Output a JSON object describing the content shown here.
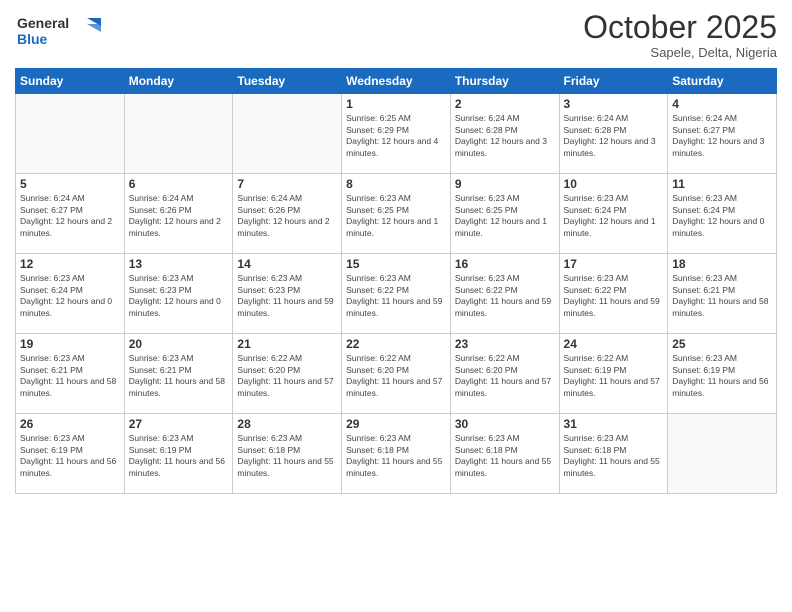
{
  "logo": {
    "text_general": "General",
    "text_blue": "Blue"
  },
  "header": {
    "month": "October 2025",
    "location": "Sapele, Delta, Nigeria"
  },
  "days_of_week": [
    "Sunday",
    "Monday",
    "Tuesday",
    "Wednesday",
    "Thursday",
    "Friday",
    "Saturday"
  ],
  "weeks": [
    [
      {
        "day": "",
        "sunrise": "",
        "sunset": "",
        "daylight": ""
      },
      {
        "day": "",
        "sunrise": "",
        "sunset": "",
        "daylight": ""
      },
      {
        "day": "",
        "sunrise": "",
        "sunset": "",
        "daylight": ""
      },
      {
        "day": "1",
        "sunrise": "Sunrise: 6:25 AM",
        "sunset": "Sunset: 6:29 PM",
        "daylight": "Daylight: 12 hours and 4 minutes."
      },
      {
        "day": "2",
        "sunrise": "Sunrise: 6:24 AM",
        "sunset": "Sunset: 6:28 PM",
        "daylight": "Daylight: 12 hours and 3 minutes."
      },
      {
        "day": "3",
        "sunrise": "Sunrise: 6:24 AM",
        "sunset": "Sunset: 6:28 PM",
        "daylight": "Daylight: 12 hours and 3 minutes."
      },
      {
        "day": "4",
        "sunrise": "Sunrise: 6:24 AM",
        "sunset": "Sunset: 6:27 PM",
        "daylight": "Daylight: 12 hours and 3 minutes."
      }
    ],
    [
      {
        "day": "5",
        "sunrise": "Sunrise: 6:24 AM",
        "sunset": "Sunset: 6:27 PM",
        "daylight": "Daylight: 12 hours and 2 minutes."
      },
      {
        "day": "6",
        "sunrise": "Sunrise: 6:24 AM",
        "sunset": "Sunset: 6:26 PM",
        "daylight": "Daylight: 12 hours and 2 minutes."
      },
      {
        "day": "7",
        "sunrise": "Sunrise: 6:24 AM",
        "sunset": "Sunset: 6:26 PM",
        "daylight": "Daylight: 12 hours and 2 minutes."
      },
      {
        "day": "8",
        "sunrise": "Sunrise: 6:23 AM",
        "sunset": "Sunset: 6:25 PM",
        "daylight": "Daylight: 12 hours and 1 minute."
      },
      {
        "day": "9",
        "sunrise": "Sunrise: 6:23 AM",
        "sunset": "Sunset: 6:25 PM",
        "daylight": "Daylight: 12 hours and 1 minute."
      },
      {
        "day": "10",
        "sunrise": "Sunrise: 6:23 AM",
        "sunset": "Sunset: 6:24 PM",
        "daylight": "Daylight: 12 hours and 1 minute."
      },
      {
        "day": "11",
        "sunrise": "Sunrise: 6:23 AM",
        "sunset": "Sunset: 6:24 PM",
        "daylight": "Daylight: 12 hours and 0 minutes."
      }
    ],
    [
      {
        "day": "12",
        "sunrise": "Sunrise: 6:23 AM",
        "sunset": "Sunset: 6:24 PM",
        "daylight": "Daylight: 12 hours and 0 minutes."
      },
      {
        "day": "13",
        "sunrise": "Sunrise: 6:23 AM",
        "sunset": "Sunset: 6:23 PM",
        "daylight": "Daylight: 12 hours and 0 minutes."
      },
      {
        "day": "14",
        "sunrise": "Sunrise: 6:23 AM",
        "sunset": "Sunset: 6:23 PM",
        "daylight": "Daylight: 11 hours and 59 minutes."
      },
      {
        "day": "15",
        "sunrise": "Sunrise: 6:23 AM",
        "sunset": "Sunset: 6:22 PM",
        "daylight": "Daylight: 11 hours and 59 minutes."
      },
      {
        "day": "16",
        "sunrise": "Sunrise: 6:23 AM",
        "sunset": "Sunset: 6:22 PM",
        "daylight": "Daylight: 11 hours and 59 minutes."
      },
      {
        "day": "17",
        "sunrise": "Sunrise: 6:23 AM",
        "sunset": "Sunset: 6:22 PM",
        "daylight": "Daylight: 11 hours and 59 minutes."
      },
      {
        "day": "18",
        "sunrise": "Sunrise: 6:23 AM",
        "sunset": "Sunset: 6:21 PM",
        "daylight": "Daylight: 11 hours and 58 minutes."
      }
    ],
    [
      {
        "day": "19",
        "sunrise": "Sunrise: 6:23 AM",
        "sunset": "Sunset: 6:21 PM",
        "daylight": "Daylight: 11 hours and 58 minutes."
      },
      {
        "day": "20",
        "sunrise": "Sunrise: 6:23 AM",
        "sunset": "Sunset: 6:21 PM",
        "daylight": "Daylight: 11 hours and 58 minutes."
      },
      {
        "day": "21",
        "sunrise": "Sunrise: 6:22 AM",
        "sunset": "Sunset: 6:20 PM",
        "daylight": "Daylight: 11 hours and 57 minutes."
      },
      {
        "day": "22",
        "sunrise": "Sunrise: 6:22 AM",
        "sunset": "Sunset: 6:20 PM",
        "daylight": "Daylight: 11 hours and 57 minutes."
      },
      {
        "day": "23",
        "sunrise": "Sunrise: 6:22 AM",
        "sunset": "Sunset: 6:20 PM",
        "daylight": "Daylight: 11 hours and 57 minutes."
      },
      {
        "day": "24",
        "sunrise": "Sunrise: 6:22 AM",
        "sunset": "Sunset: 6:19 PM",
        "daylight": "Daylight: 11 hours and 57 minutes."
      },
      {
        "day": "25",
        "sunrise": "Sunrise: 6:23 AM",
        "sunset": "Sunset: 6:19 PM",
        "daylight": "Daylight: 11 hours and 56 minutes."
      }
    ],
    [
      {
        "day": "26",
        "sunrise": "Sunrise: 6:23 AM",
        "sunset": "Sunset: 6:19 PM",
        "daylight": "Daylight: 11 hours and 56 minutes."
      },
      {
        "day": "27",
        "sunrise": "Sunrise: 6:23 AM",
        "sunset": "Sunset: 6:19 PM",
        "daylight": "Daylight: 11 hours and 56 minutes."
      },
      {
        "day": "28",
        "sunrise": "Sunrise: 6:23 AM",
        "sunset": "Sunset: 6:18 PM",
        "daylight": "Daylight: 11 hours and 55 minutes."
      },
      {
        "day": "29",
        "sunrise": "Sunrise: 6:23 AM",
        "sunset": "Sunset: 6:18 PM",
        "daylight": "Daylight: 11 hours and 55 minutes."
      },
      {
        "day": "30",
        "sunrise": "Sunrise: 6:23 AM",
        "sunset": "Sunset: 6:18 PM",
        "daylight": "Daylight: 11 hours and 55 minutes."
      },
      {
        "day": "31",
        "sunrise": "Sunrise: 6:23 AM",
        "sunset": "Sunset: 6:18 PM",
        "daylight": "Daylight: 11 hours and 55 minutes."
      },
      {
        "day": "",
        "sunrise": "",
        "sunset": "",
        "daylight": ""
      }
    ]
  ]
}
